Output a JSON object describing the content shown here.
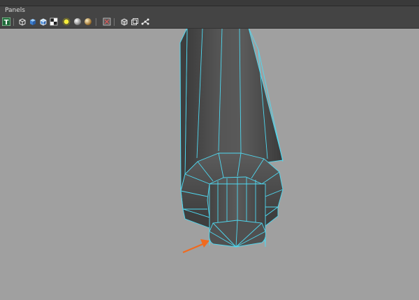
{
  "menubar": {
    "panels_label": "Panels"
  },
  "toolbar": {
    "items": [
      {
        "icon": "text-tool-icon",
        "label": "T"
      },
      {
        "icon": "wireframe-cube-icon"
      },
      {
        "icon": "smooth-shade-cube-icon"
      },
      {
        "icon": "wireframe-on-shaded-cube-icon"
      },
      {
        "icon": "checker-texture-icon"
      },
      {
        "icon": "default-light-icon"
      },
      {
        "icon": "all-lights-sphere-icon"
      },
      {
        "icon": "shadows-sphere-icon"
      },
      {
        "icon": "xray-isolate-icon"
      },
      {
        "icon": "isolate-select-cube-icon"
      },
      {
        "icon": "xray-cube-icon"
      },
      {
        "icon": "joint-xray-icon"
      }
    ]
  },
  "viewport": {
    "background_color": "#a0a0a0",
    "mesh_color": "#4c4c4c",
    "wire_color": "#4fd8f0",
    "annotation_arrow_color": "#f06a1e"
  }
}
